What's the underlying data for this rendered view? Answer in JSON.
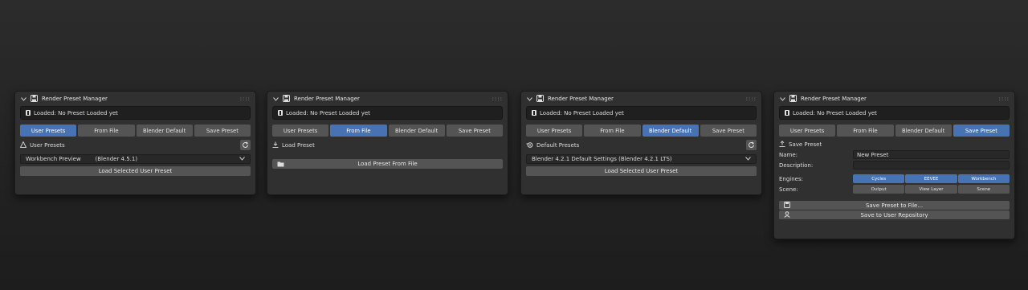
{
  "panel_title": "Render Preset Manager",
  "grip": "::::",
  "status_text": "Loaded: No Preset Loaded yet",
  "tabs": [
    "User Presets",
    "From File",
    "Blender Default",
    "Save Preset"
  ],
  "panel1": {
    "active_tab": 0,
    "section_label": "User Presets",
    "select_value": "Workbench Preview        (Blender 4.5.1)",
    "button": "Load Selected User Preset"
  },
  "panel2": {
    "active_tab": 1,
    "section_label": "Load Preset",
    "button": "Load Preset From File"
  },
  "panel3": {
    "active_tab": 2,
    "section_label": "Default Presets",
    "select_value": "Blender 4.2.1 Default Settings (Blender 4.2.1 LTS)",
    "button": "Load Selected User Preset"
  },
  "panel4": {
    "active_tab": 3,
    "section_label": "Save Preset",
    "name_label": "Name:",
    "name_value": "New Preset",
    "description_label": "Description:",
    "description_value": "",
    "engines_label": "Engines:",
    "engines": [
      {
        "label": "Cycles",
        "on": true
      },
      {
        "label": "EEVEE",
        "on": true
      },
      {
        "label": "Workbench",
        "on": true
      }
    ],
    "scene_label": "Scene:",
    "scene_items": [
      {
        "label": "Output",
        "on": false
      },
      {
        "label": "View Layer",
        "on": false
      },
      {
        "label": "Scene",
        "on": false
      }
    ],
    "save_file_button": "Save Preset to File...",
    "save_repo_button": "Save to User Repository"
  },
  "colors": {
    "accent": "#4772b3",
    "button": "#545454",
    "panel": "#303030",
    "field": "#282828"
  }
}
